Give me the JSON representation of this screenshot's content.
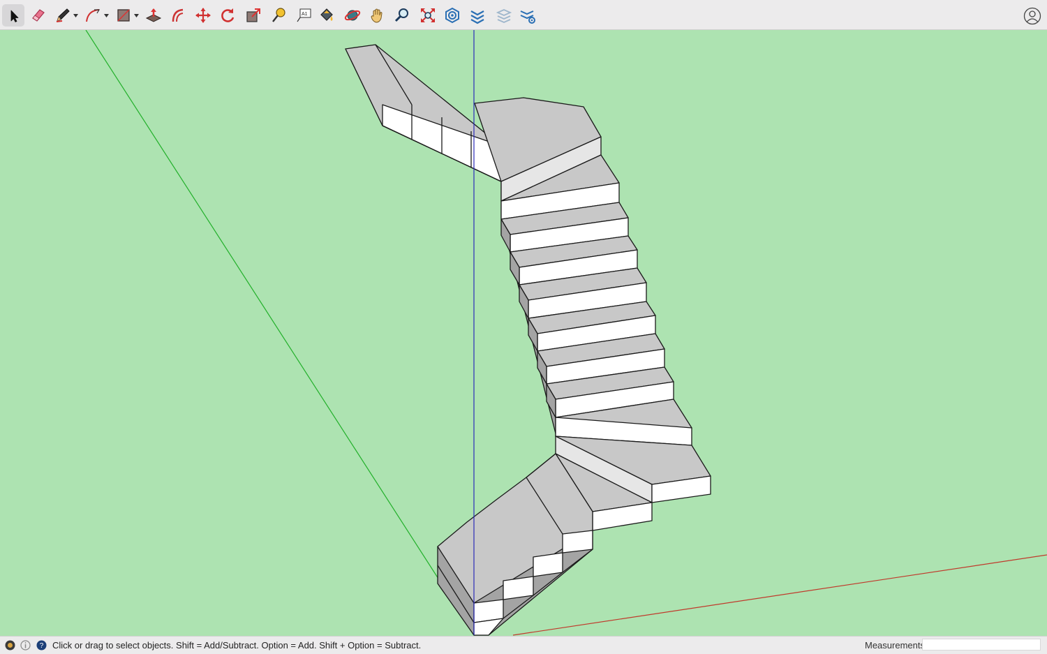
{
  "toolbar": {
    "tools": [
      {
        "id": "select",
        "icon": "select-arrow-icon",
        "active": true
      },
      {
        "id": "eraser",
        "icon": "eraser-icon"
      },
      {
        "id": "line",
        "icon": "pencil-icon",
        "has_menu": true
      },
      {
        "id": "arc",
        "icon": "arc-icon",
        "has_menu": true
      },
      {
        "id": "shapes",
        "icon": "rectangle-shape-icon",
        "has_menu": true
      },
      {
        "id": "push-pull",
        "icon": "push-pull-icon"
      },
      {
        "id": "offset",
        "icon": "offset-icon"
      },
      {
        "id": "move",
        "icon": "move-icon"
      },
      {
        "id": "rotate",
        "icon": "rotate-icon"
      },
      {
        "id": "scale",
        "icon": "scale-icon"
      },
      {
        "id": "tape-measure",
        "icon": "tape-measure-icon"
      },
      {
        "id": "text",
        "icon": "text-icon",
        "label": "A1"
      },
      {
        "id": "paint-bucket",
        "icon": "paint-bucket-icon"
      },
      {
        "id": "orbit",
        "icon": "orbit-icon"
      },
      {
        "id": "pan",
        "icon": "pan-hand-icon"
      },
      {
        "id": "zoom",
        "icon": "zoom-magnifier-icon"
      },
      {
        "id": "zoom-extents",
        "icon": "zoom-extents-icon"
      },
      {
        "id": "warehouse",
        "icon": "3d-warehouse-icon"
      },
      {
        "id": "extension-warehouse",
        "icon": "extension-warehouse-icon"
      },
      {
        "id": "layout",
        "icon": "send-to-layout-icon",
        "disabled": true
      },
      {
        "id": "extension-manager",
        "icon": "extension-manager-icon"
      }
    ],
    "account_icon": "account-user-icon"
  },
  "colors": {
    "background": "#ade3b1",
    "toolbar": "#ecebec",
    "axis_red": "#c0392b",
    "axis_green": "#22b02a",
    "axis_blue": "#2b2bb8",
    "face_top": "#c8c8c8",
    "face_riser": "#ffffff",
    "face_side": "#a4a4a4",
    "edge": "#1a1a1a"
  },
  "statusbar": {
    "icons": [
      "geo-location-icon",
      "credits-info-icon",
      "help-question-icon"
    ],
    "message": "Click or drag to select objects. Shift = Add/Subtract. Option = Add. Shift + Option = Subtract.",
    "measurements_label": "Measurements",
    "measurements_value": ""
  }
}
